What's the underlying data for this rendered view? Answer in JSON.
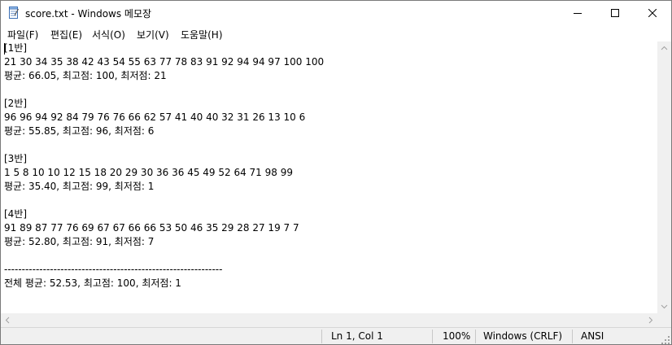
{
  "window": {
    "title": "score.txt - Windows 메모장"
  },
  "menu": {
    "items": [
      "파일(F)",
      "편집(E)",
      "서식(O)",
      "보기(V)",
      "도움말(H)"
    ]
  },
  "editor": {
    "content": "[1반]\n21 30 34 35 38 42 43 54 55 63 77 78 83 91 92 94 94 97 100 100\n평균: 66.05, 최고점: 100, 최저점: 21\n\n[2반]\n96 96 94 92 84 79 76 76 66 62 57 41 40 40 32 31 26 13 10 6\n평균: 55.85, 최고점: 96, 최저점: 6\n\n[3반]\n1 5 8 10 10 12 15 18 20 29 30 36 36 45 49 52 64 71 98 99\n평균: 35.40, 최고점: 99, 최저점: 1\n\n[4반]\n91 89 87 77 76 69 67 67 66 66 53 50 46 35 29 28 27 19 7 7\n평균: 52.80, 최고점: 91, 최저점: 7\n\n--------------------------------------------------------------\n전체 평균: 52.53, 최고점: 100, 최저점: 1"
  },
  "status": {
    "position": "Ln 1, Col 1",
    "zoom": "100%",
    "line_ending": "Windows (CRLF)",
    "encoding": "ANSI"
  },
  "icons": {
    "app": "notepad-icon",
    "minimize": "minimize-icon",
    "maximize": "maximize-icon",
    "close": "close-icon"
  }
}
